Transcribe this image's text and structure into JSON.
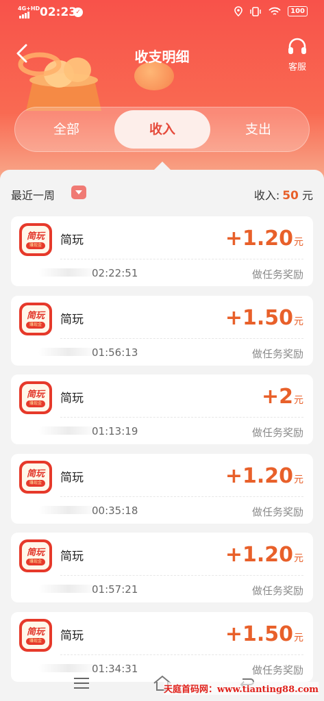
{
  "status_bar": {
    "network": "4G+HD",
    "time": "02:23",
    "battery": "100",
    "icons": [
      "location-icon",
      "vibrate-icon",
      "wifi-icon",
      "battery-icon"
    ]
  },
  "header": {
    "title": "收支明细",
    "service_label": "客服"
  },
  "tabs": [
    {
      "label": "全部",
      "active": false
    },
    {
      "label": "收入",
      "active": true
    },
    {
      "label": "支出",
      "active": false
    }
  ],
  "filter": {
    "period_label": "最近一周",
    "income_label": "收入:",
    "income_value": "50",
    "income_unit": "元"
  },
  "app_icon_text": "简玩",
  "app_icon_sub": "赚现金",
  "records": [
    {
      "name": "简玩",
      "amount": "+1.20",
      "unit": "元",
      "time": "02:22:51",
      "desc": "做任务奖励"
    },
    {
      "name": "简玩",
      "amount": "+1.50",
      "unit": "元",
      "time": "01:56:13",
      "desc": "做任务奖励"
    },
    {
      "name": "简玩",
      "amount": "+2",
      "unit": "元",
      "time": "01:13:19",
      "desc": "做任务奖励"
    },
    {
      "name": "简玩",
      "amount": "+1.20",
      "unit": "元",
      "time": "00:35:18",
      "desc": "做任务奖励"
    },
    {
      "name": "简玩",
      "amount": "+1.20",
      "unit": "元",
      "time": "01:57:21",
      "desc": "做任务奖励"
    },
    {
      "name": "简玩",
      "amount": "+1.50",
      "unit": "元",
      "time": "01:34:31",
      "desc": "做任务奖励"
    }
  ],
  "watermark": "天庭首码网：www.tianting88.com",
  "colors": {
    "header_top": "#f8524a",
    "amount": "#e8602a",
    "active_tab_text": "#e54b3c"
  }
}
